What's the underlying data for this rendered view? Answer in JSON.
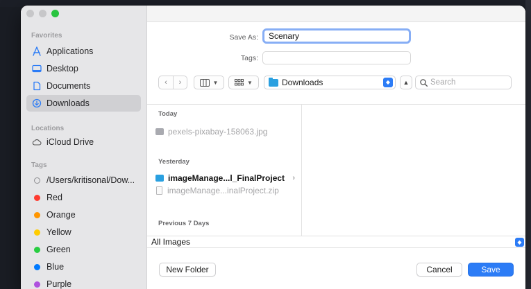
{
  "sidebar": {
    "favorites_header": "Favorites",
    "favorites": [
      {
        "label": "Applications",
        "icon": "applications-icon"
      },
      {
        "label": "Desktop",
        "icon": "desktop-icon"
      },
      {
        "label": "Documents",
        "icon": "documents-icon"
      },
      {
        "label": "Downloads",
        "icon": "downloads-icon",
        "selected": true
      }
    ],
    "locations_header": "Locations",
    "locations": [
      {
        "label": "iCloud Drive",
        "icon": "cloud-icon"
      }
    ],
    "tags_header": "Tags",
    "tags": [
      {
        "label": "/Users/kritisonal/Dow...",
        "color": ""
      },
      {
        "label": "Red",
        "color": "#ff3b30"
      },
      {
        "label": "Orange",
        "color": "#ff9500"
      },
      {
        "label": "Yellow",
        "color": "#ffcc00"
      },
      {
        "label": "Green",
        "color": "#28cd41"
      },
      {
        "label": "Blue",
        "color": "#007aff"
      },
      {
        "label": "Purple",
        "color": "#af52de"
      }
    ]
  },
  "form": {
    "save_as_label": "Save As:",
    "save_as_value": "Scenary",
    "tags_label": "Tags:",
    "tags_value": ""
  },
  "toolbar": {
    "location": "Downloads",
    "search_placeholder": "Search"
  },
  "browser": {
    "groups": [
      {
        "header": "Today",
        "items": [
          {
            "name": "pexels-pixabay-158063.jpg",
            "kind": "image",
            "enabled": false
          }
        ]
      },
      {
        "header": "Yesterday",
        "items": [
          {
            "name": "imageManage...l_FinalProject",
            "kind": "folder",
            "enabled": true
          },
          {
            "name": "imageManage...inalProject.zip",
            "kind": "zip",
            "enabled": false
          }
        ]
      },
      {
        "header": "Previous 7 Days",
        "items": []
      }
    ]
  },
  "format": {
    "value": "All Images"
  },
  "buttons": {
    "new_folder": "New Folder",
    "cancel": "Cancel",
    "save": "Save"
  },
  "colors": {
    "accent": "#2c7cf6",
    "sidebar_bg": "#e6e6e8",
    "selection_bg": "#d0d0d3"
  }
}
